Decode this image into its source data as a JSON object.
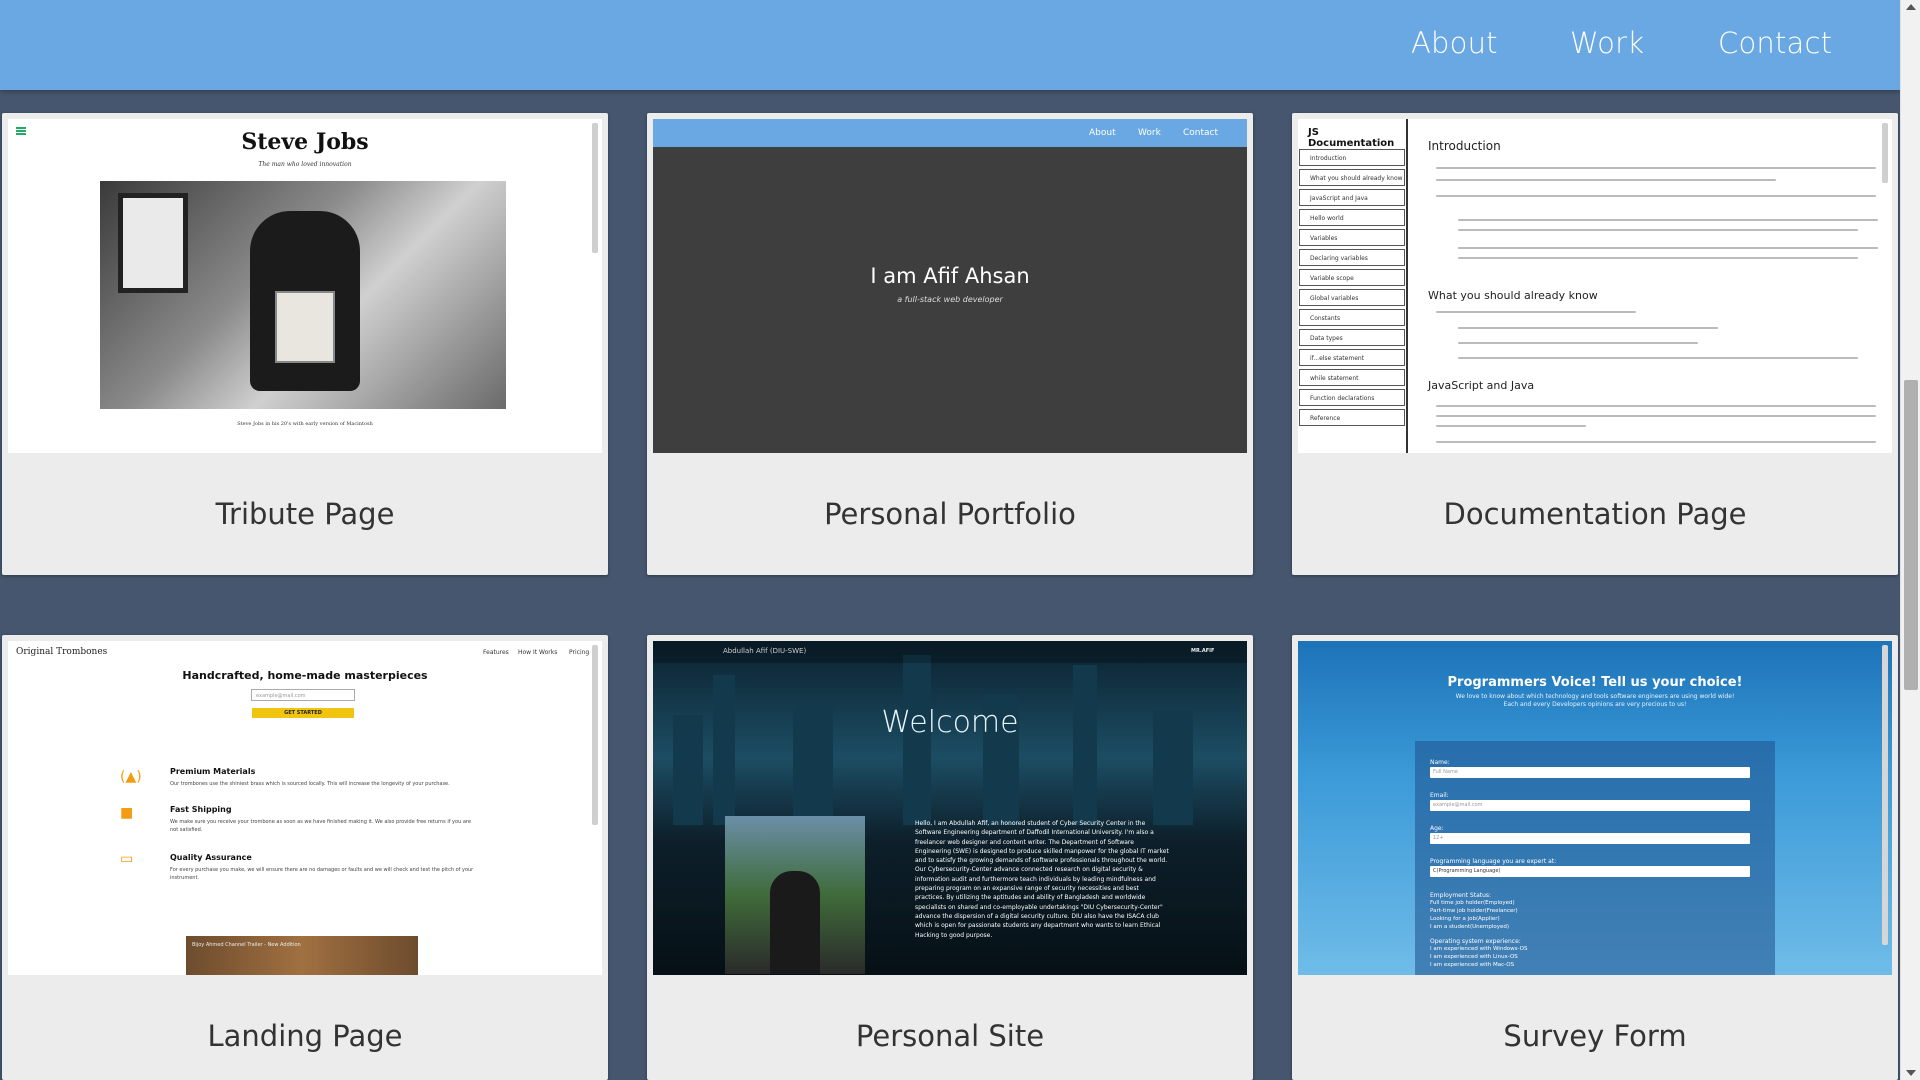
{
  "nav": {
    "about": "About",
    "work": "Work",
    "contact": "Contact"
  },
  "projects": [
    {
      "title": "Tribute Page",
      "preview": {
        "heading": "Steve Jobs",
        "subtitle": "The man who loved innovation",
        "caption": "Steve Jobs in his 20's with early version of Macintosh"
      }
    },
    {
      "title": "Personal Portfolio",
      "preview": {
        "nav": [
          "About",
          "Work",
          "Contact"
        ],
        "name": "I am Afif Ahsan",
        "role": "a full-stack web developer"
      }
    },
    {
      "title": "Documentation Page",
      "preview": {
        "heading": "JS Documentation",
        "nav": [
          "Introduction",
          "What you should already know",
          "JavaScript and Java",
          "Hello world",
          "Variables",
          "Declaring variables",
          "Variable scope",
          "Global variables",
          "Constants",
          "Data types",
          "if...else statement",
          "while statement",
          "Function declarations",
          "Reference"
        ],
        "sections": [
          "Introduction",
          "What you should already know",
          "JavaScript and Java"
        ]
      }
    },
    {
      "title": "Landing Page",
      "preview": {
        "logo": "Original Trombones",
        "nav": [
          "Features",
          "How It Works",
          "Pricing"
        ],
        "hero": "Handcrafted, home-made masterpieces",
        "email_placeholder": "example@mail.com",
        "cta": "GET STARTED",
        "features": [
          {
            "title": "Premium Materials",
            "text": "Our trombones use the shiniest brass which is sourced locally. This will increase the longevity of your purchase."
          },
          {
            "title": "Fast Shipping",
            "text": "We make sure you receive your trombone as soon as we have finished making it. We also provide free returns if you are not satisfied."
          },
          {
            "title": "Quality Assurance",
            "text": "For every purchase you make, we will ensure there are no damages or faults and we will check and test the pitch of your instrument."
          }
        ],
        "video_title": "Bijoy Ahmed Channel Trailer - New Addition"
      }
    },
    {
      "title": "Personal Site",
      "preview": {
        "brand": "Abdullah Afif (DIU-SWE)",
        "menu": "MR.AFIF",
        "welcome": "Welcome",
        "bio": "Hello, I am Abdullah Afif, an honored student of Cyber Security Center in the Software Engineering department of Daffodil International University. I'm also a freelancer web designer and content writer. The Department of Software Engineering (SWE) is designed to produce skilled manpower for the global IT market and to satisfy the growing demands of software professionals throughout the world. Our Cybersecurity-Center advance connected research on digital security & information audit and furthermore teach individuals by leading mindfulness and preparing program on an expansive range of security necessities and best practices. By utilizing the aptitudes and ability of Bangladesh and worldwide specialists on shared and co-employable undertakings \"DIU Cybersecurity-Center\" advance the dispersion of a digital security culture. DIU also have the ISACA club which is open for passionate students any department who wants to learn Ethical Hacking to good purpose."
      }
    },
    {
      "title": "Survey Form",
      "preview": {
        "heading": "Programmers Voice! Tell us your choice!",
        "intro": "We love to know about which technology and tools software engineers are using world wide! Each and every Developers opinions are very precious to us!",
        "name_label": "Name:",
        "name_placeholder": "Full Name",
        "email_label": "Email:",
        "email_placeholder": "example@mail.com",
        "age_label": "Age:",
        "age_placeholder": "12+",
        "lang_label": "Programming language you are expert at:",
        "lang_value": "C(Programming Language)",
        "employment_label": "Employment Status:",
        "employment": [
          "Full time job holder(Employed)",
          "Part-time job holder(Freelancer)",
          "Looking for a job(Applier)",
          "I am a student(Unemployed)"
        ],
        "os_label": "Operating system experience:",
        "os": [
          "I am experienced with Windows-OS",
          "I am experienced with Linux-OS",
          "I am experienced with Mac-OS"
        ]
      }
    }
  ]
}
